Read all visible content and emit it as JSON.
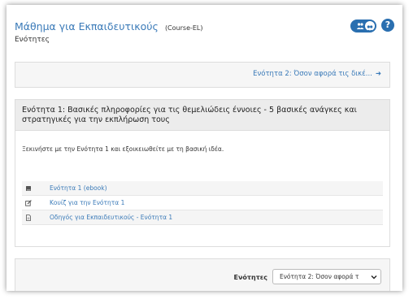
{
  "header": {
    "course_title": "Μάθημα για Εκπαιδευτικούς",
    "course_code": "(Course-EL)",
    "subtitle": "Ενότητες",
    "help_label": "?",
    "colors": {
      "accent": "#2a6fb0",
      "link": "#3a7ab8"
    }
  },
  "nav": {
    "next_section_label": "Ενότητα 2: Όσον αφορά τις δικέ...",
    "next_icon": "arrow-right-icon"
  },
  "section": {
    "title": "Ενότητα 1: Βασικές πληροφορίες για τις θεμελιώδεις έννοιες - 5 βασικές ανάγκες και στρατηγικές για την εκπλήρωση τους",
    "intro": "Ξεκινήστε με την Ενότητα 1 και εξοικειωθείτε με τη βασική ιδέα.",
    "activities": [
      {
        "label": "Ενότητα 1 (ebook)",
        "icon": "book-icon"
      },
      {
        "label": "Κουίζ για την Ενότητα 1",
        "icon": "edit-icon"
      },
      {
        "label": "Οδηγός για Εκπαιδευτικούς - Ενότητα 1",
        "icon": "file-icon"
      }
    ]
  },
  "footer": {
    "label": "Ενότητες",
    "select_value": "Ενότητα 2: Όσον αφορά τ"
  }
}
